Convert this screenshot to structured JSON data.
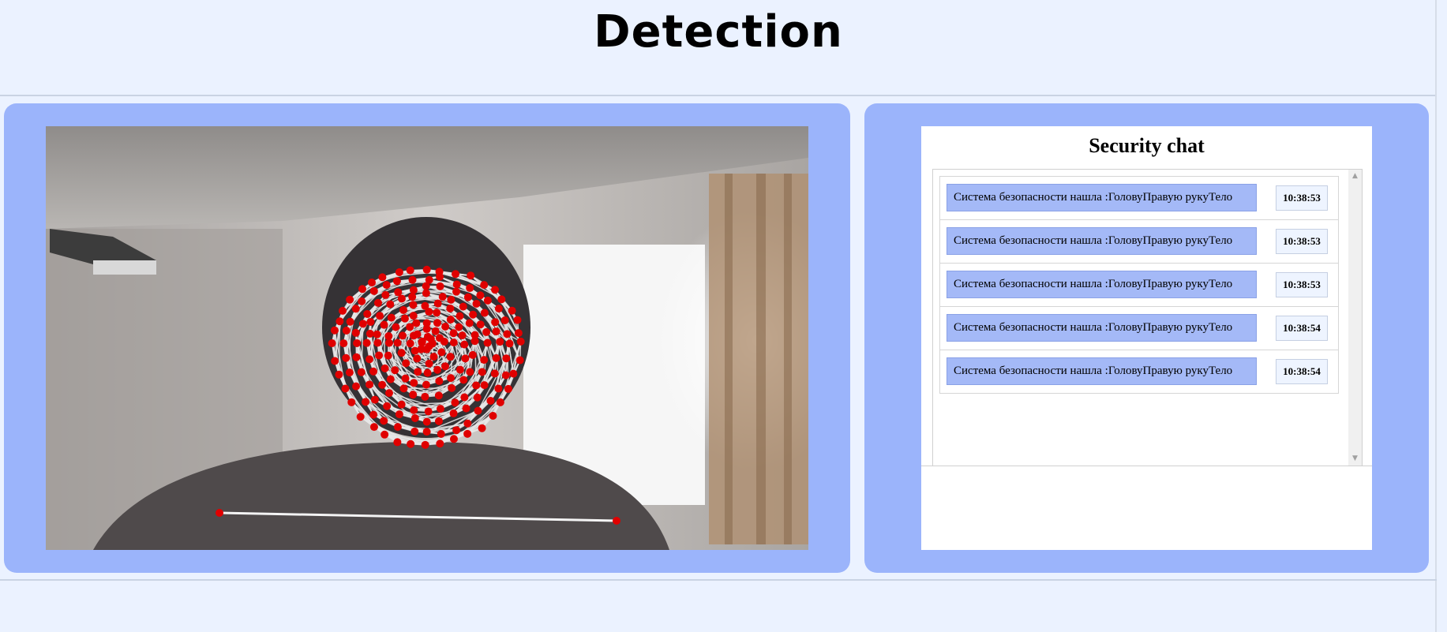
{
  "header": {
    "title": "Detection"
  },
  "video": {
    "description_icon": "webcam-feed"
  },
  "chat": {
    "title": "Security chat",
    "messages": [
      {
        "text": "Система безопасности нашла :ГоловуПравую рукуТело",
        "time": "10:38:53"
      },
      {
        "text": "Система безопасности нашла :ГоловуПравую рукуТело",
        "time": "10:38:53"
      },
      {
        "text": "Система безопасности нашла :ГоловуПравую рукуТело",
        "time": "10:38:53"
      },
      {
        "text": "Система безопасности нашла :ГоловуПравую рукуТело",
        "time": "10:38:54"
      },
      {
        "text": "Система безопасности нашла :ГоловуПравую рукуТело",
        "time": "10:38:54"
      }
    ],
    "scroll_up_icon": "scroll-up-arrow-icon",
    "scroll_down_icon": "scroll-down-arrow-icon"
  },
  "colors": {
    "page_bg": "#ebf2ff",
    "panel_bg": "#9bb4fb",
    "message_bg": "#a4b9f7",
    "landmark": "#e00000"
  }
}
